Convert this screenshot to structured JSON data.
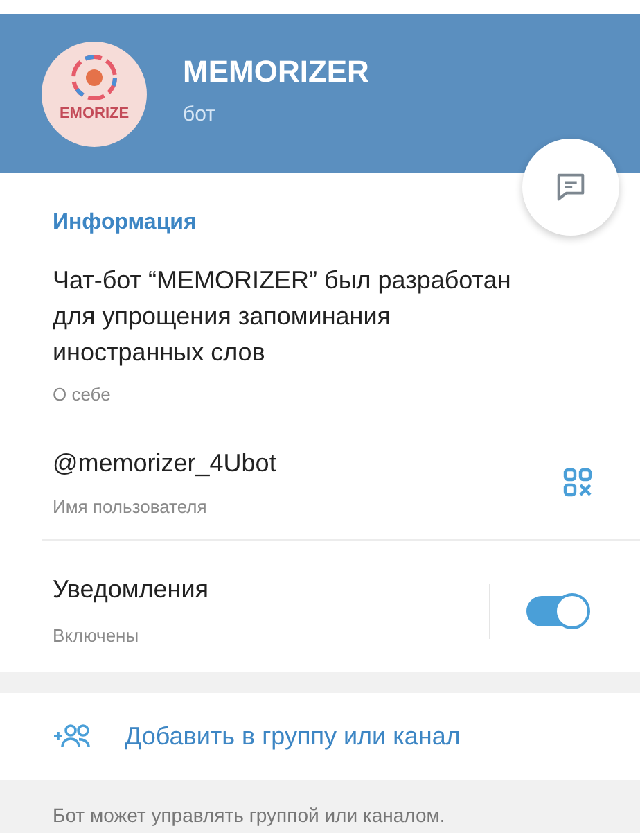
{
  "header": {
    "avatar_text": "EMORIZE",
    "name": "MEMORIZER",
    "subtitle": "бот"
  },
  "info": {
    "title": "Информация",
    "about": {
      "value": "Чат-бот “MEMORIZER” был разработан для упрощения запоминания иностранных слов",
      "label": "О себе"
    },
    "username": {
      "value": "@memorizer_4Ubot",
      "label": "Имя пользователя"
    },
    "notifications": {
      "value": "Уведомления",
      "label": "Включены",
      "on": true
    }
  },
  "add_action": {
    "label": "Добавить в группу или канал"
  },
  "footer_note": "Бот может управлять группой или каналом."
}
